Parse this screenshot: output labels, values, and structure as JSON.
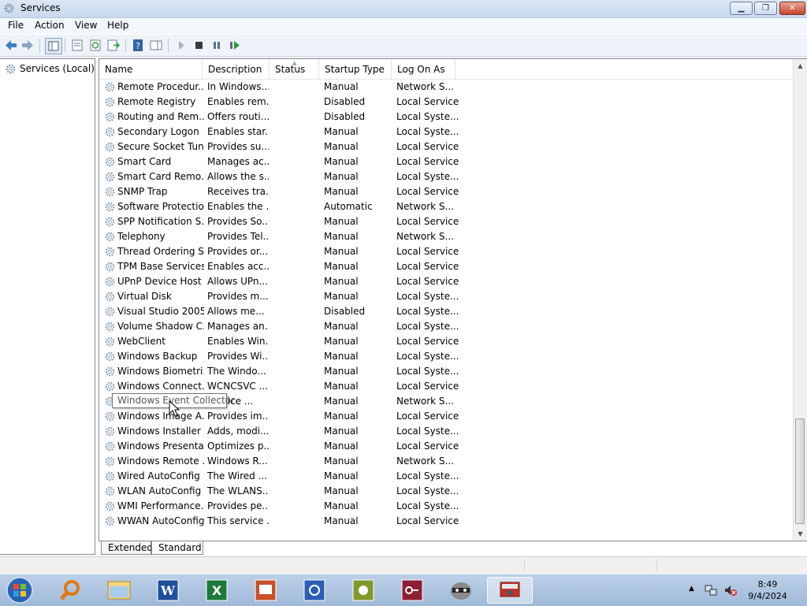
{
  "window": {
    "title": "Services"
  },
  "menu": {
    "file": "File",
    "action": "Action",
    "view": "View",
    "help": "Help"
  },
  "tree": {
    "root": "Services (Local)"
  },
  "columns": {
    "name": "Name",
    "description": "Description",
    "status": "Status",
    "startup": "Startup Type",
    "logon": "Log On As"
  },
  "services": [
    {
      "name": "Remote Procedur...",
      "description": "In Windows...",
      "status": "",
      "startup": "Manual",
      "logon": "Network S..."
    },
    {
      "name": "Remote Registry",
      "description": "Enables rem...",
      "status": "",
      "startup": "Disabled",
      "logon": "Local Service"
    },
    {
      "name": "Routing and Rem...",
      "description": "Offers routi...",
      "status": "",
      "startup": "Disabled",
      "logon": "Local Syste..."
    },
    {
      "name": "Secondary Logon",
      "description": "Enables star...",
      "status": "",
      "startup": "Manual",
      "logon": "Local Syste..."
    },
    {
      "name": "Secure Socket Tun...",
      "description": "Provides su...",
      "status": "",
      "startup": "Manual",
      "logon": "Local Service"
    },
    {
      "name": "Smart Card",
      "description": "Manages ac...",
      "status": "",
      "startup": "Manual",
      "logon": "Local Service"
    },
    {
      "name": "Smart Card Remo...",
      "description": "Allows the s...",
      "status": "",
      "startup": "Manual",
      "logon": "Local Syste..."
    },
    {
      "name": "SNMP Trap",
      "description": "Receives tra...",
      "status": "",
      "startup": "Manual",
      "logon": "Local Service"
    },
    {
      "name": "Software Protection",
      "description": "Enables the ...",
      "status": "",
      "startup": "Automatic",
      "logon": "Network S..."
    },
    {
      "name": "SPP Notification S...",
      "description": "Provides So...",
      "status": "",
      "startup": "Manual",
      "logon": "Local Service"
    },
    {
      "name": "Telephony",
      "description": "Provides Tel...",
      "status": "",
      "startup": "Manual",
      "logon": "Network S..."
    },
    {
      "name": "Thread Ordering S...",
      "description": "Provides or...",
      "status": "",
      "startup": "Manual",
      "logon": "Local Service"
    },
    {
      "name": "TPM Base Services",
      "description": "Enables acc...",
      "status": "",
      "startup": "Manual",
      "logon": "Local Service"
    },
    {
      "name": "UPnP Device Host",
      "description": "Allows UPn...",
      "status": "",
      "startup": "Manual",
      "logon": "Local Service"
    },
    {
      "name": "Virtual Disk",
      "description": "Provides m...",
      "status": "",
      "startup": "Manual",
      "logon": "Local Syste..."
    },
    {
      "name": "Visual Studio 2005...",
      "description": "Allows me...",
      "status": "",
      "startup": "Disabled",
      "logon": "Local Syste..."
    },
    {
      "name": "Volume Shadow C...",
      "description": "Manages an...",
      "status": "",
      "startup": "Manual",
      "logon": "Local Syste..."
    },
    {
      "name": "WebClient",
      "description": "Enables Win...",
      "status": "",
      "startup": "Manual",
      "logon": "Local Service"
    },
    {
      "name": "Windows Backup",
      "description": "Provides Wi...",
      "status": "",
      "startup": "Manual",
      "logon": "Local Syste..."
    },
    {
      "name": "Windows Biometri...",
      "description": "The Windo...",
      "status": "",
      "startup": "Manual",
      "logon": "Local Syste..."
    },
    {
      "name": "Windows Connect...",
      "description": "WCNCSVC ...",
      "status": "",
      "startup": "Manual",
      "logon": "Local Service"
    },
    {
      "name": "",
      "description": "service ...",
      "status": "",
      "startup": "Manual",
      "logon": "Network S..."
    },
    {
      "name": "Windows Image A...",
      "description": "Provides im...",
      "status": "",
      "startup": "Manual",
      "logon": "Local Service"
    },
    {
      "name": "Windows Installer",
      "description": "Adds, modi...",
      "status": "",
      "startup": "Manual",
      "logon": "Local Syste..."
    },
    {
      "name": "Windows Presenta...",
      "description": "Optimizes p...",
      "status": "",
      "startup": "Manual",
      "logon": "Local Service"
    },
    {
      "name": "Windows Remote ...",
      "description": "Windows R...",
      "status": "",
      "startup": "Manual",
      "logon": "Network S..."
    },
    {
      "name": "Wired AutoConfig",
      "description": "The Wired ...",
      "status": "",
      "startup": "Manual",
      "logon": "Local Syste..."
    },
    {
      "name": "WLAN AutoConfig",
      "description": "The WLANS...",
      "status": "",
      "startup": "Manual",
      "logon": "Local Syste..."
    },
    {
      "name": "WMI Performance...",
      "description": "Provides pe...",
      "status": "",
      "startup": "Manual",
      "logon": "Local Syste..."
    },
    {
      "name": "WWAN AutoConfig",
      "description": "This service ...",
      "status": "",
      "startup": "Manual",
      "logon": "Local Service"
    }
  ],
  "tooltip": {
    "text": "Windows Event Collector"
  },
  "tabs": {
    "extended": "Extended",
    "standard": "Standard"
  },
  "taskbar": {
    "apps": [
      "search-icon",
      "explorer-icon",
      "word-icon",
      "excel-icon",
      "powerpoint-icon",
      "visio-icon",
      "publisher-icon",
      "access-icon",
      "raccoon-icon",
      "services-icon"
    ],
    "clock_time": "8:49",
    "clock_date": "9/4/2024"
  },
  "colors": {
    "accent": "#3a6ea5",
    "gear": "#8aa0b8",
    "title_bg": "#dbe6f4",
    "taskbar_bg": "#aec5e1"
  }
}
